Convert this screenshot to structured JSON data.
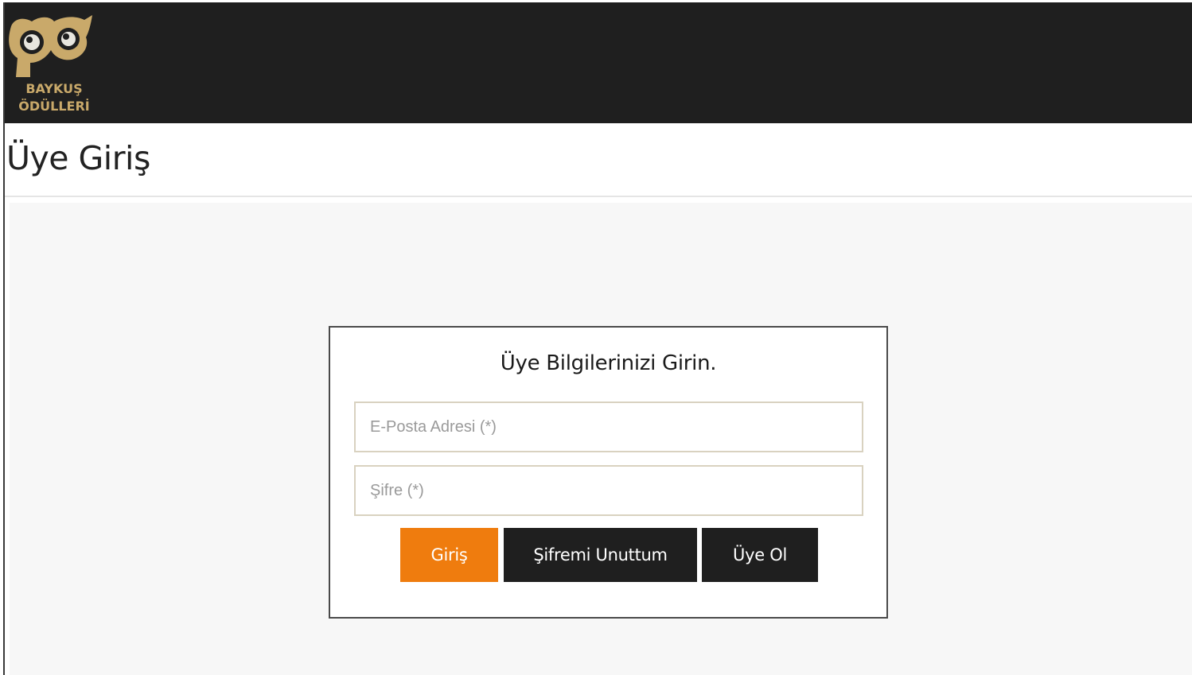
{
  "brand": {
    "logo_line1": "BAYKUŞ",
    "logo_line2": "ÖDÜLLERİ",
    "logo_color": "#c9a96a",
    "header_bg": "#1f1f1f"
  },
  "page": {
    "title": "Üye Giriş"
  },
  "login": {
    "heading": "Üye Bilgilerinizi Girin.",
    "email_placeholder": "E-Posta Adresi (*)",
    "password_placeholder": "Şifre (*)",
    "login_label": "Giriş",
    "forgot_label": "Şifremi Unuttum",
    "register_label": "Üye Ol",
    "accent_color": "#ef7c0e",
    "dark_button_color": "#1f1f1f"
  },
  "icons": {
    "logo": "owl-logo-icon"
  }
}
